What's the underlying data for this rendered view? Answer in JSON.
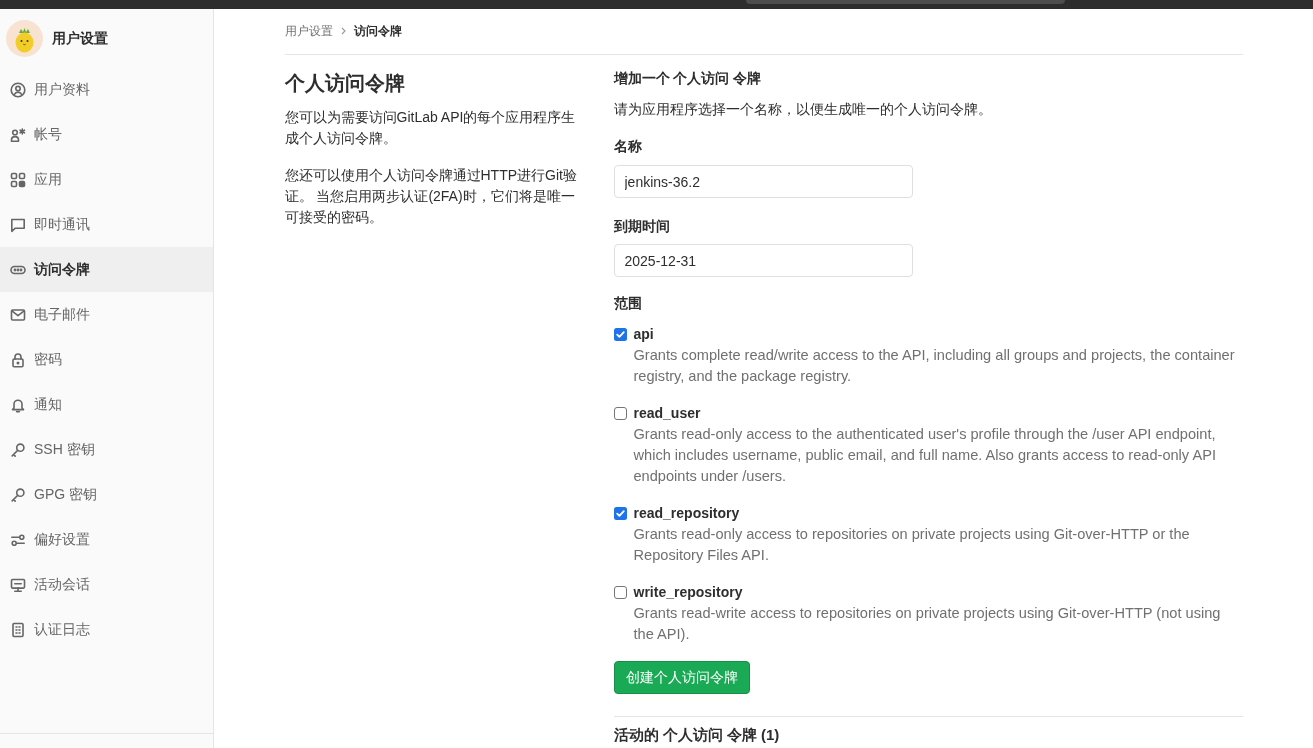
{
  "sidebar": {
    "title": "用户设置",
    "items": [
      {
        "label": "用户资料",
        "kind": "profile",
        "selected": false
      },
      {
        "label": "帐号",
        "kind": "account",
        "selected": false
      },
      {
        "label": "应用",
        "kind": "applications",
        "selected": false
      },
      {
        "label": "即时通讯",
        "kind": "chat",
        "selected": false
      },
      {
        "label": "访问令牌",
        "kind": "token",
        "selected": true
      },
      {
        "label": "电子邮件",
        "kind": "email",
        "selected": false
      },
      {
        "label": "密码",
        "kind": "password",
        "selected": false
      },
      {
        "label": "通知",
        "kind": "notifications",
        "selected": false
      },
      {
        "label": "SSH 密钥",
        "kind": "key",
        "selected": false
      },
      {
        "label": "GPG 密钥",
        "kind": "key",
        "selected": false
      },
      {
        "label": "偏好设置",
        "kind": "preferences",
        "selected": false
      },
      {
        "label": "活动会话",
        "kind": "sessions",
        "selected": false
      },
      {
        "label": "认证日志",
        "kind": "log",
        "selected": false
      }
    ]
  },
  "breadcrumb": [
    {
      "label": "用户设置",
      "current": false
    },
    {
      "label": "访问令牌",
      "current": true
    }
  ],
  "intro": {
    "title": "个人访问令牌",
    "paragraphs": [
      "您可以为需要访问GitLab API的每个应用程序生成个人访问令牌。",
      "您还可以使用个人访问令牌通过HTTP进行Git验证。 当您启用两步认证(2FA)时，它们将是唯一可接受的密码。"
    ]
  },
  "form": {
    "heading": "增加一个 个人访问 令牌",
    "description": "请为应用程序选择一个名称，以便生成唯一的个人访问令牌。",
    "fields": [
      {
        "label": "名称",
        "value": "jenkins-36.2"
      },
      {
        "label": "到期时间",
        "value": "2025-12-31"
      }
    ],
    "scopes_label": "范围",
    "scopes": [
      {
        "name": "api",
        "checked": true,
        "description": "Grants complete read/write access to the API, including all groups and projects, the container registry, and the package registry."
      },
      {
        "name": "read_user",
        "checked": false,
        "description": "Grants read-only access to the authenticated user's profile through the /user API endpoint, which includes username, public email, and full name. Also grants access to read-only API endpoints under /users."
      },
      {
        "name": "read_repository",
        "checked": true,
        "description": "Grants read-only access to repositories on private projects using Git-over-HTTP or the Repository Files API."
      },
      {
        "name": "write_repository",
        "checked": false,
        "description": "Grants read-write access to repositories on private projects using Git-over-HTTP (not using the API)."
      }
    ],
    "submit_button": "创建个人访问令牌"
  },
  "active_tokens": {
    "heading": "活动的 个人访问 令牌 (1)"
  }
}
